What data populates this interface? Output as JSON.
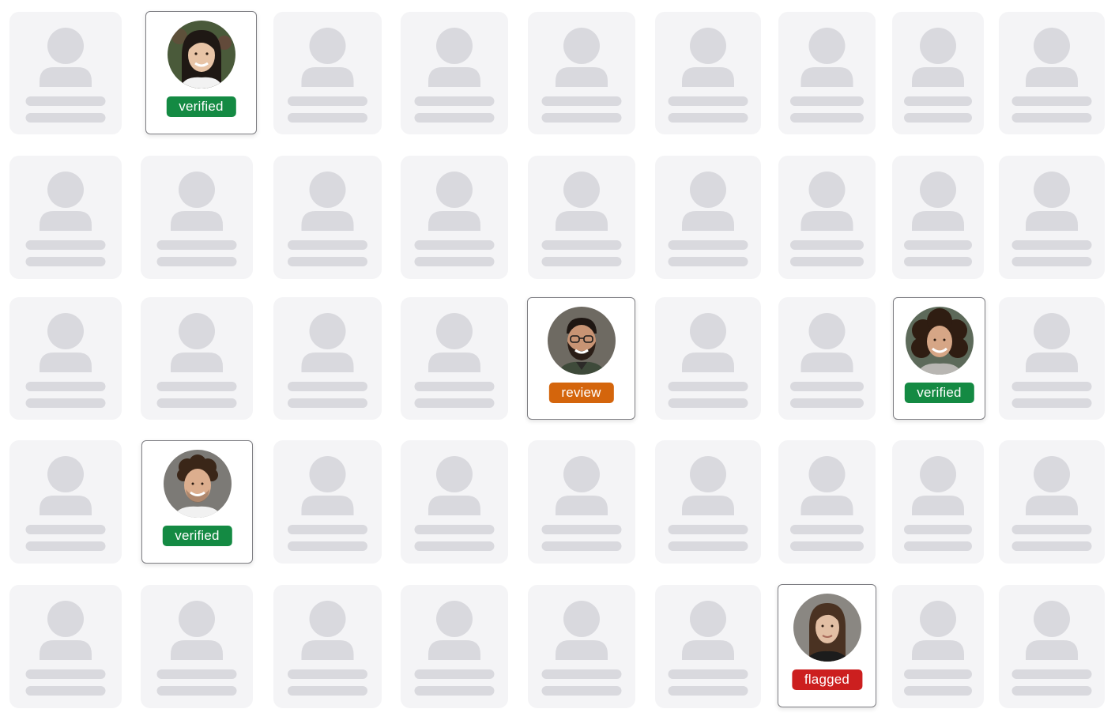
{
  "colors": {
    "placeholder_card": "#f4f4f6",
    "placeholder_shape": "#d9d9de",
    "verified": "#148a43",
    "review": "#d4650c",
    "flagged": "#cc1f1f"
  },
  "cards": [
    [
      {
        "type": "placeholder"
      },
      {
        "type": "profile",
        "status": "verified",
        "avatar": "woman-long-dark-hair"
      },
      {
        "type": "placeholder"
      },
      {
        "type": "placeholder"
      },
      {
        "type": "placeholder"
      },
      {
        "type": "placeholder"
      },
      {
        "type": "placeholder"
      },
      {
        "type": "placeholder"
      },
      {
        "type": "placeholder"
      }
    ],
    [
      {
        "type": "placeholder"
      },
      {
        "type": "placeholder"
      },
      {
        "type": "placeholder"
      },
      {
        "type": "placeholder"
      },
      {
        "type": "placeholder"
      },
      {
        "type": "placeholder"
      },
      {
        "type": "placeholder"
      },
      {
        "type": "placeholder"
      },
      {
        "type": "placeholder"
      }
    ],
    [
      {
        "type": "placeholder"
      },
      {
        "type": "placeholder"
      },
      {
        "type": "placeholder"
      },
      {
        "type": "placeholder"
      },
      {
        "type": "profile",
        "status": "review",
        "avatar": "man-beard-glasses"
      },
      {
        "type": "placeholder"
      },
      {
        "type": "placeholder"
      },
      {
        "type": "profile",
        "status": "verified",
        "avatar": "woman-curly-hair"
      },
      {
        "type": "placeholder"
      }
    ],
    [
      {
        "type": "placeholder"
      },
      {
        "type": "profile",
        "status": "verified",
        "avatar": "man-curly-hair"
      },
      {
        "type": "placeholder"
      },
      {
        "type": "placeholder"
      },
      {
        "type": "placeholder"
      },
      {
        "type": "placeholder"
      },
      {
        "type": "placeholder"
      },
      {
        "type": "placeholder"
      },
      {
        "type": "placeholder"
      }
    ],
    [
      {
        "type": "placeholder"
      },
      {
        "type": "placeholder"
      },
      {
        "type": "placeholder"
      },
      {
        "type": "placeholder"
      },
      {
        "type": "placeholder"
      },
      {
        "type": "placeholder"
      },
      {
        "type": "profile",
        "status": "flagged",
        "avatar": "woman-brown-hair"
      },
      {
        "type": "placeholder"
      },
      {
        "type": "placeholder"
      }
    ]
  ]
}
